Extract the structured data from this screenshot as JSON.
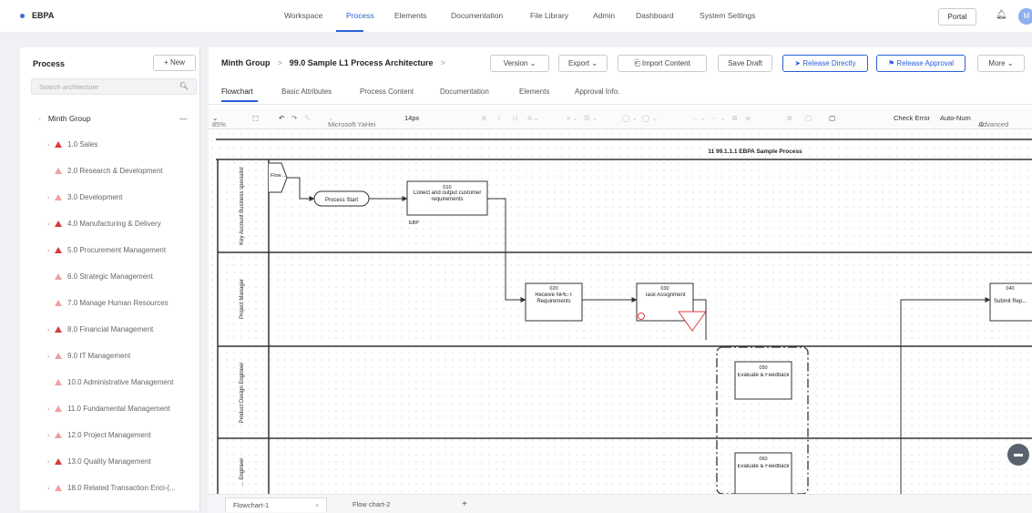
{
  "app": {
    "name": "EBPA"
  },
  "nav": {
    "items": [
      "Workspace",
      "Process",
      "Elements",
      "Documentation",
      "File Library",
      "Admin",
      "Dashboard",
      "System Settings"
    ],
    "active": "Process"
  },
  "header_right": {
    "portal_label": "Portal",
    "avatar_initial": "M"
  },
  "sidebar": {
    "title": "Process",
    "new_label": "+ New",
    "search_placeholder": "Search architecture",
    "root": {
      "label": "Minth Group",
      "collapse": "—"
    },
    "items": [
      {
        "label": "1.0 Sales",
        "expandable": true,
        "icon_style": "dark"
      },
      {
        "label": "2.0 Research & Development",
        "expandable": false,
        "icon_style": "light"
      },
      {
        "label": "3.0 Development",
        "expandable": true,
        "icon_style": "light"
      },
      {
        "label": "4.0 Manufacturing & Delivery",
        "expandable": true,
        "icon_style": "dark"
      },
      {
        "label": "5.0 Procurement Management",
        "expandable": true,
        "icon_style": "dark"
      },
      {
        "label": "6.0 Strategic Management",
        "expandable": false,
        "icon_style": "light"
      },
      {
        "label": "7.0 Manage Human Resources",
        "expandable": false,
        "icon_style": "light"
      },
      {
        "label": "8.0 Financial Management",
        "expandable": true,
        "icon_style": "dark"
      },
      {
        "label": "9.0 IT Management",
        "expandable": true,
        "icon_style": "light"
      },
      {
        "label": "10.0 Administrative Management",
        "expandable": false,
        "icon_style": "light"
      },
      {
        "label": "11.0 Fundamental Management",
        "expandable": true,
        "icon_style": "light"
      },
      {
        "label": "12.0 Project Management",
        "expandable": true,
        "icon_style": "light"
      },
      {
        "label": "13.0 Quality Management",
        "expandable": true,
        "icon_style": "dark"
      },
      {
        "label": "18.0 Related Transaction Enci-(...",
        "expandable": true,
        "icon_style": "light"
      }
    ]
  },
  "breadcrumb": {
    "group": "Minth Group",
    "process": "99.0 Sample L1 Process Architecture"
  },
  "actions": {
    "version": "Version",
    "export": "Export",
    "import": "Import Content",
    "save_draft": "Save Draft",
    "release_directly": "Release Directly",
    "release_approval": "Release Approval",
    "more": "More"
  },
  "tabs": [
    "Flowchart",
    "Basic Attributes",
    "Process Content",
    "Documentation",
    "Elements",
    "Approval Info."
  ],
  "active_tab": "Flowchart",
  "toolbar": {
    "zoom": "85%",
    "font": "Microsoft YaHei",
    "font_size": "14px",
    "check_error": "Check Error",
    "auto_num": "Auto-Num",
    "advanced": "Advanced"
  },
  "diagram": {
    "title": "11 99.1.1.1 EBPA Sample Process",
    "lanes": [
      "Key Account Business specialist",
      "Project Manager",
      "Product Design Engineer",
      "... Engineer"
    ],
    "nodes": {
      "start_event": "Process Start",
      "entry": "Flow ...",
      "n010_num": "010",
      "n010_text": "Collect and output customer requirements",
      "ebp_label": "EBP",
      "n020_num": "020",
      "n020_text": "Receive NPE-T Requirements",
      "n030_num": "030",
      "n030_text": "Task Assignment",
      "n050_num": "050",
      "n050_text": "Evaluate & Feedback",
      "n060_num": "060",
      "n060_text": "Evaluate & Feedback",
      "n040_num": "040",
      "n040_text": "Submit Rep..."
    }
  },
  "bottom_tabs": [
    "Flowchart-1",
    "Flow chart-2"
  ],
  "colors": {
    "accent": "#2a5fd6",
    "icon_dark": "#d63a3a",
    "icon_light": "#f0a0a0",
    "risk": "#e03c3c"
  }
}
